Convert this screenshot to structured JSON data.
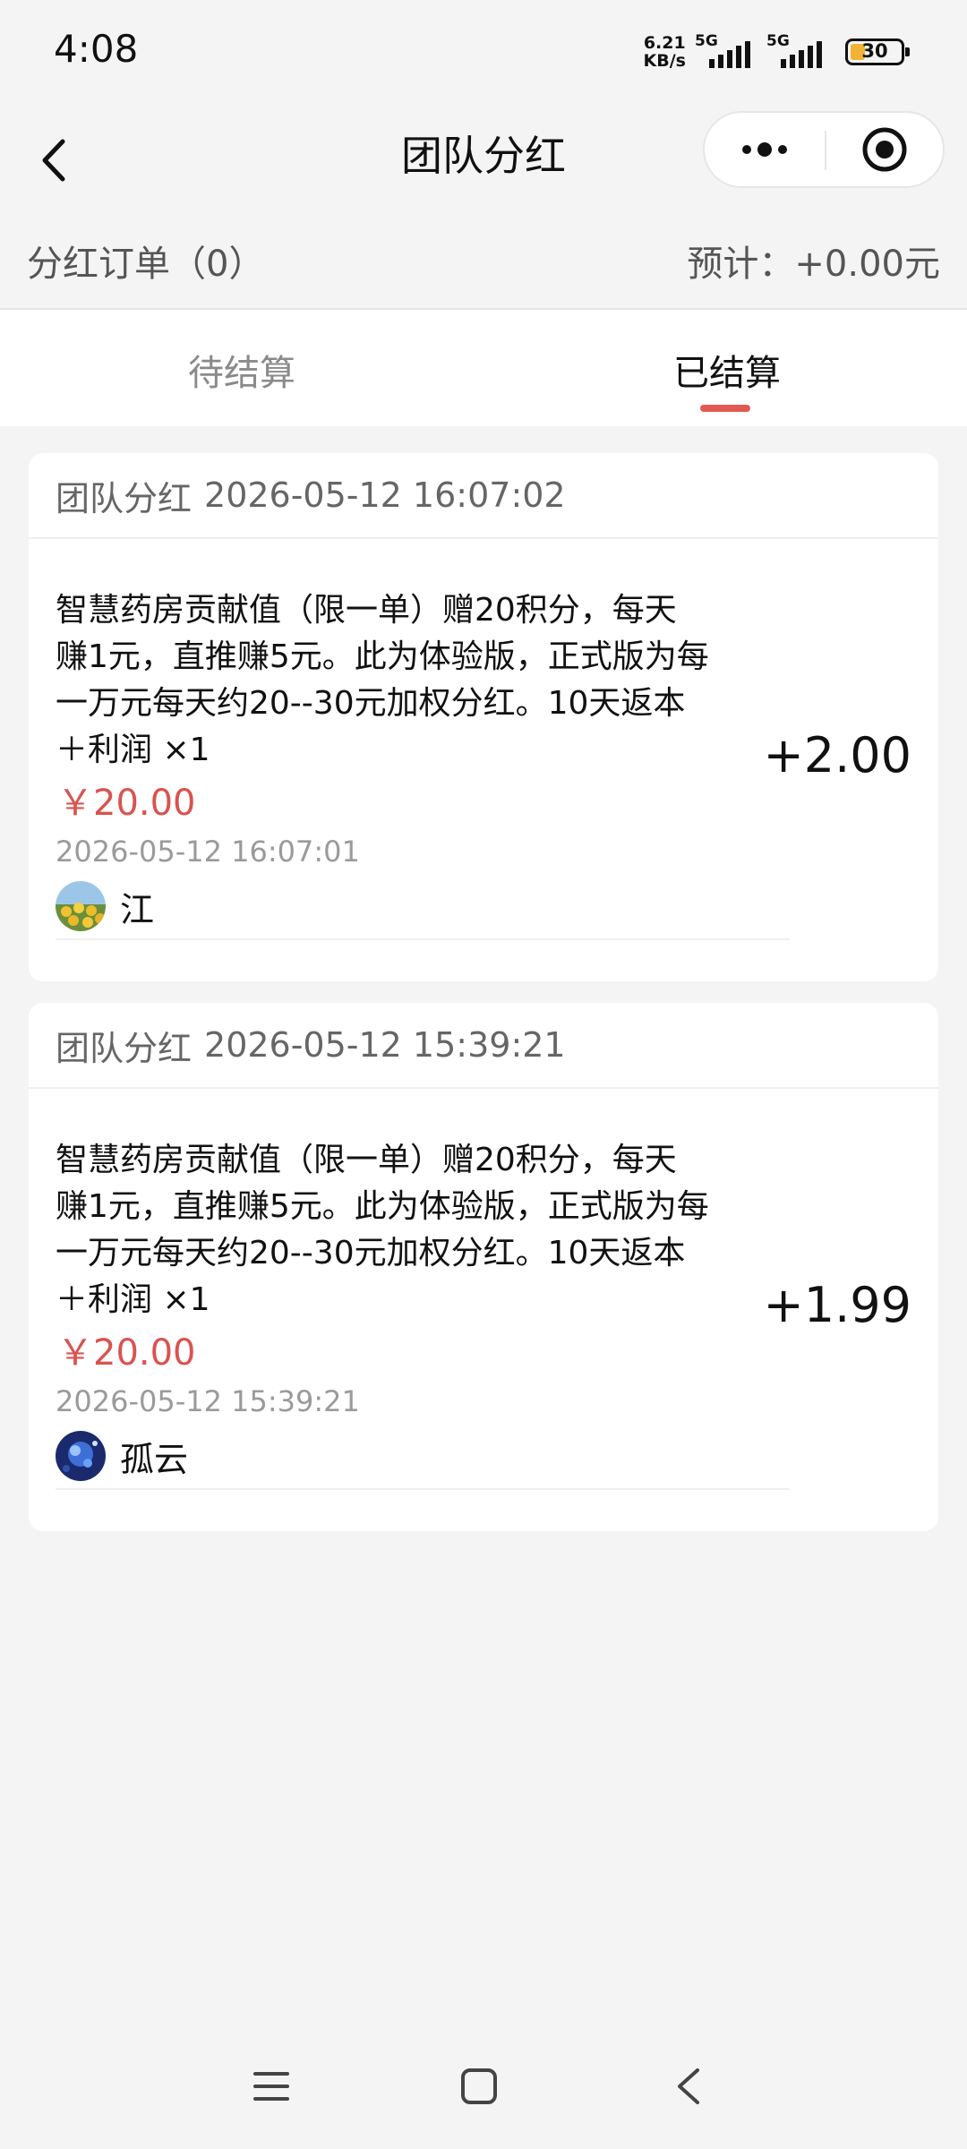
{
  "status_bar": {
    "time": "4:08",
    "net_speed_value": "6.21",
    "net_speed_unit": "KB/s",
    "sim1_label": "5G",
    "sim2_label": "5G",
    "battery": "30",
    "battery_level": 0.3
  },
  "nav": {
    "title": "团队分红",
    "more_icon": "more-dots-icon",
    "target_icon": "target-icon"
  },
  "summary": {
    "orders_label": "分红订单（0）",
    "estimate_label": "预计：+0.00元"
  },
  "tabs": [
    {
      "label": "待结算",
      "active": false
    },
    {
      "label": "已结算",
      "active": true
    }
  ],
  "colors": {
    "accent": "#e05a52",
    "price": "#d9534f"
  },
  "records": [
    {
      "head_label": "团队分红",
      "head_time": "2026-05-12 16:07:02",
      "description": "智慧药房贡献值（限一单）赠20积分，每天\n赚1元，直推赚5元。此为体验版，正式版为每\n一万元每天约20--30元加权分红。10天返本\n＋利润 ×1",
      "price": "￥20.00",
      "order_time": "2026-05-12 16:07:01",
      "user_name": "江",
      "amount": "+2.00"
    },
    {
      "head_label": "团队分红",
      "head_time": "2026-05-12 15:39:21",
      "description": "智慧药房贡献值（限一单）赠20积分，每天\n赚1元，直推赚5元。此为体验版，正式版为每\n一万元每天约20--30元加权分红。10天返本\n＋利润 ×1",
      "price": "￥20.00",
      "order_time": "2026-05-12 15:39:21",
      "user_name": "孤云",
      "amount": "+1.99"
    }
  ],
  "system_nav": {
    "menu_icon": "menu-icon",
    "home_icon": "home-square-icon",
    "back_icon": "back-arrow-icon"
  }
}
